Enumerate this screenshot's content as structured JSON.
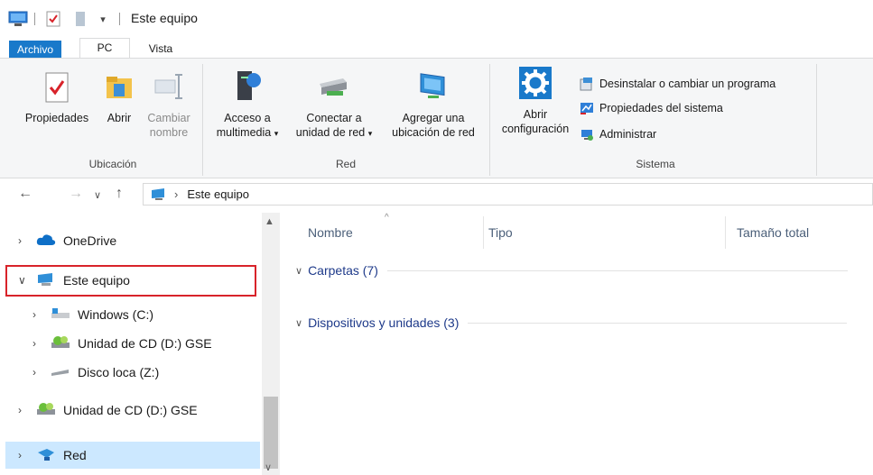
{
  "window": {
    "title": "Este equipo"
  },
  "ribbon_tabs": [
    "Archivo",
    "PC",
    "Vista"
  ],
  "ribbon": {
    "groups": [
      {
        "label": "Ubicación"
      },
      {
        "label": "Red"
      },
      {
        "label": "Sistema"
      }
    ],
    "buttons": {
      "propiedades": "Propiedades",
      "abrir": "Abrir",
      "cambiar_nombre_1": "Cambiar",
      "cambiar_nombre_2": "nombre",
      "acceso_1": "Acceso a",
      "acceso_2": "multimedia",
      "conectar_1": "Conectar a",
      "conectar_2": "unidad de red",
      "agregar_1": "Agregar una",
      "agregar_2": "ubicación de red",
      "abrir_config_1": "Abrir",
      "abrir_config_2": "configuración",
      "desinstalar": "Desinstalar o cambiar un programa",
      "propiedades_sistema": "Propiedades del sistema",
      "administrar": "Administrar"
    }
  },
  "address": {
    "path": "Este equipo"
  },
  "sidebar": {
    "items": [
      {
        "label": "OneDrive",
        "icon": "cloud-icon"
      },
      {
        "label": "Este equipo",
        "icon": "computer-icon"
      },
      {
        "label": "Windows (C:)",
        "icon": "drive-icon"
      },
      {
        "label": "Unidad de CD (D:) GSE",
        "icon": "cd-drive-icon"
      },
      {
        "label": "Disco loca (Z:)",
        "icon": "network-drive-icon"
      },
      {
        "label": "Unidad de CD (D:) GSE",
        "icon": "cd-drive-icon"
      },
      {
        "label": "Red",
        "icon": "network-icon"
      }
    ]
  },
  "content": {
    "columns": [
      "Nombre",
      "Tipo",
      "Tamaño total"
    ],
    "groups": [
      "Carpetas (7)",
      "Dispositivos y unidades (3)"
    ]
  },
  "colors": {
    "accent": "#1979ca",
    "highlight_border": "#d8232a",
    "selected": "#cce8ff"
  }
}
